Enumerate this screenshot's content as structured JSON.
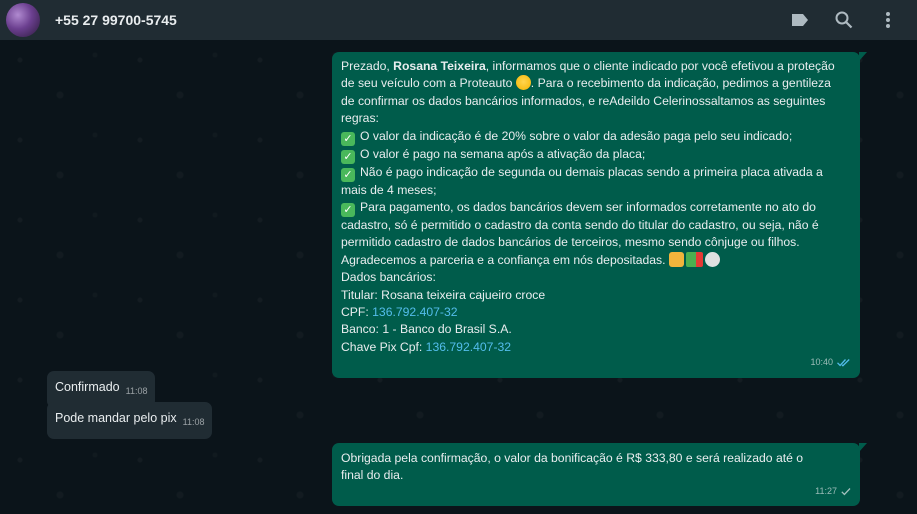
{
  "header": {
    "contact_name": "+55 27 99700-5745",
    "icons": [
      "label-icon",
      "search-icon",
      "menu-dots-icon"
    ]
  },
  "messages": {
    "m1": {
      "greeting": "Prezado, ",
      "name": "Rosana Teixeira",
      "intro1": ", informamos que o cliente indicado por você efetivou a proteção",
      "intro2": "de seu veículo com a Proteauto ",
      "intro2b": ". Para o recebimento da indicação, pedimos a gentileza",
      "intro3": "de confirmar os dados bancários informados, e reAdeildo Celerinossaltamos as seguintes",
      "intro4": "regras:",
      "rule1": "O valor da indicação é de 20% sobre o valor da adesão paga pelo seu indicado;",
      "rule2": "O valor é pago na semana após a ativação da placa;",
      "rule3a": "Não é pago indicação de segunda ou demais placas sendo a primeira placa ativada a",
      "rule3b": "mais de 4 meses;",
      "rule4a": "Para pagamento, os dados bancários devem ser informados corretamente no ato do",
      "rule4b": "cadastro, só é permitido o cadastro da conta sendo do titular do cadastro, ou seja, não é",
      "rule4c": "permitido cadastro de dados bancários de terceiros, mesmo sendo cônjuge ou filhos.",
      "thanks": "Agradecemos a parceria e a confiança em nós depositadas. ",
      "bank_header": "Dados bancários:",
      "holder": "Titular: Rosana teixeira cajueiro croce",
      "cpf_label": "CPF: ",
      "cpf": "136.792.407-32",
      "bank": "Banco: 1 - Banco do Brasil S.A.",
      "pix_label": "Chave Pix Cpf: ",
      "pix": "136.792.407-32",
      "time": "10:40"
    },
    "m2": {
      "text": "Confirmado",
      "time": "11:08"
    },
    "m3": {
      "text": "Pode mandar pelo pix",
      "time": "11:08"
    },
    "m4": {
      "line1": "Obrigada pela confirmação, o valor da bonificação é R$ 333,80 e será realizado até o",
      "line2": "final do dia.",
      "time": "11:27"
    }
  },
  "colors": {
    "outgoing_bubble": "#005c4b",
    "incoming_bubble": "#202c33",
    "header": "#202c33",
    "link": "#53bdeb",
    "read_ticks": "#53bdeb"
  }
}
